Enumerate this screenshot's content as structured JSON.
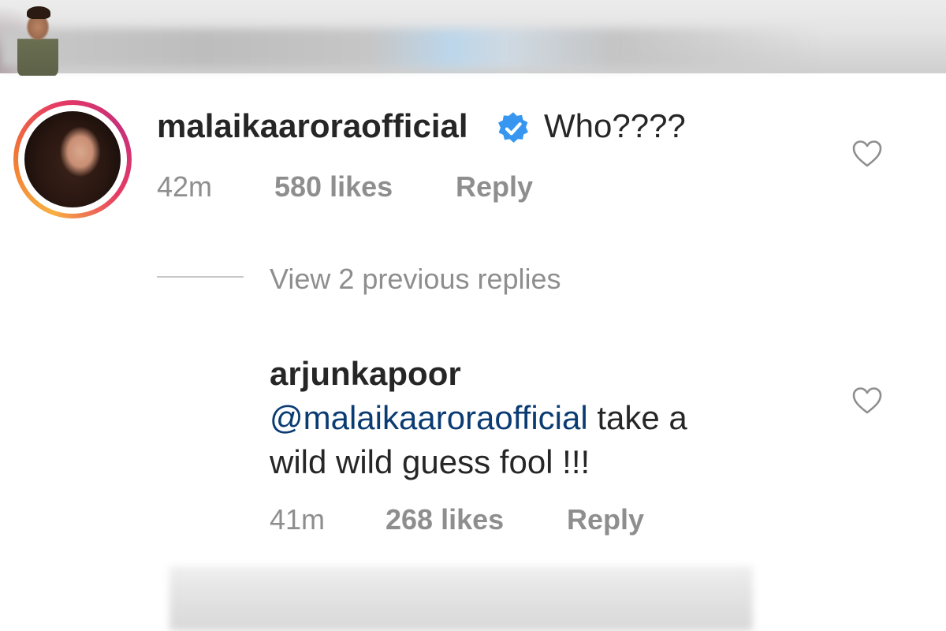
{
  "comments": [
    {
      "username": "malaikaaroraofficial",
      "verified": true,
      "text": "Who????",
      "time": "42m",
      "likes": "580 likes",
      "reply_label": "Reply"
    },
    {
      "username": "arjunkapoor",
      "verified": false,
      "mention": "@malaikaaroraofficial",
      "text_line1": " take a",
      "text_line2": "wild wild guess fool !!!",
      "time": "41m",
      "likes": "268 likes",
      "reply_label": "Reply"
    }
  ],
  "replies_toggle": {
    "label": "View 2 previous replies"
  },
  "colors": {
    "text": "#262626",
    "meta": "#8e8e8e",
    "mention": "#0b3b73",
    "verified": "#3797f0",
    "story_ring_start": "#f7b041",
    "story_ring_end": "#c7307a"
  }
}
